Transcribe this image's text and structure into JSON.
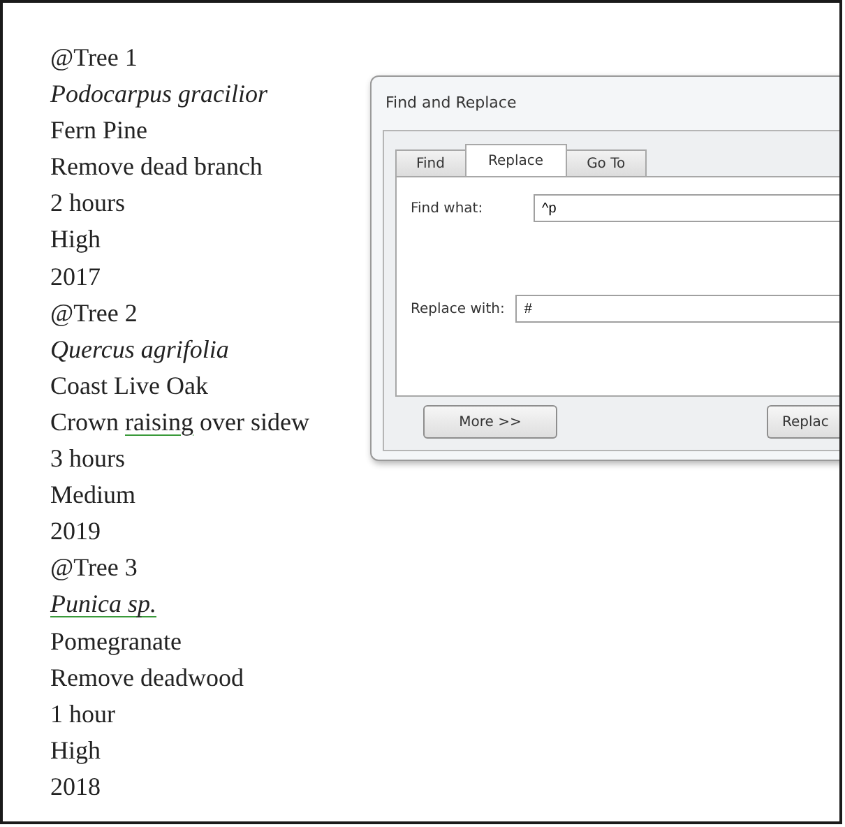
{
  "document": {
    "lines": [
      {
        "parts": [
          {
            "text": "@Tree 1"
          }
        ],
        "italic": false
      },
      {
        "parts": [
          {
            "text": "Podocarpus gracilior"
          }
        ],
        "italic": true
      },
      {
        "parts": [
          {
            "text": "Fern Pine"
          }
        ],
        "italic": false
      },
      {
        "parts": [
          {
            "text": "Remove dead branch"
          }
        ],
        "italic": false
      },
      {
        "parts": [
          {
            "text": "2 hours"
          }
        ],
        "italic": false
      },
      {
        "parts": [
          {
            "text": "High"
          }
        ],
        "italic": false
      },
      {
        "parts": [
          {
            "text": "2017"
          }
        ],
        "italic": false
      },
      {
        "parts": [
          {
            "text": "@Tree 2"
          }
        ],
        "italic": false
      },
      {
        "parts": [
          {
            "text": "Quercus agrifolia"
          }
        ],
        "italic": true
      },
      {
        "parts": [
          {
            "text": "Coast Live Oak"
          }
        ],
        "italic": false
      },
      {
        "parts": [
          {
            "text": "Crown "
          },
          {
            "text": "raising",
            "flagged": true
          },
          {
            "text": " over sidew"
          }
        ],
        "italic": false
      },
      {
        "parts": [
          {
            "text": "3 hours"
          }
        ],
        "italic": false
      },
      {
        "parts": [
          {
            "text": "Medium"
          }
        ],
        "italic": false
      },
      {
        "parts": [
          {
            "text": "2019"
          }
        ],
        "italic": false
      },
      {
        "parts": [
          {
            "text": "@Tree 3"
          }
        ],
        "italic": false
      },
      {
        "parts": [
          {
            "text": "Punica sp.",
            "flagged": true
          }
        ],
        "italic": true
      },
      {
        "parts": [
          {
            "text": "Pomegranate"
          }
        ],
        "italic": false
      },
      {
        "parts": [
          {
            "text": "Remove deadwood"
          }
        ],
        "italic": false
      },
      {
        "parts": [
          {
            "text": "1 hour"
          }
        ],
        "italic": false
      },
      {
        "parts": [
          {
            "text": "High"
          }
        ],
        "italic": false
      },
      {
        "parts": [
          {
            "text": "2018"
          }
        ],
        "italic": false
      }
    ]
  },
  "dialog": {
    "title": "Find and Replace",
    "tabs": [
      {
        "label": "Find",
        "selected": false
      },
      {
        "label": "Replace",
        "selected": true
      },
      {
        "label": "Go To",
        "selected": false
      }
    ],
    "fields": [
      {
        "label": "Find what:",
        "value": "^p"
      },
      {
        "label": "Replace with:",
        "value": "#"
      }
    ],
    "buttons": [
      "More >>",
      "Replac"
    ]
  }
}
